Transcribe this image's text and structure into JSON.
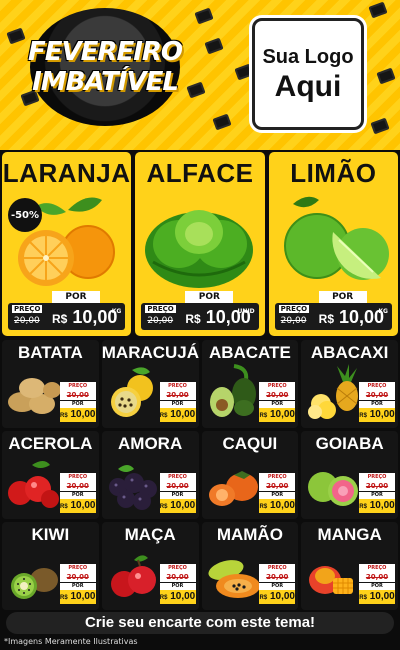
{
  "header": {
    "headline_line1": "FEVEREIRO",
    "headline_line2": "IMBATÍVEL",
    "logo_line1": "Sua Logo",
    "logo_line2": "Aqui",
    "colors": {
      "accent": "#ffd21a",
      "background": "#0c0c0c"
    }
  },
  "featured": [
    {
      "name": "LARANJA",
      "discount": "-50%",
      "price_label": "PREÇO",
      "old_price": "20,00",
      "por": "POR",
      "currency": "R$",
      "price": "10,00",
      "unit": "KG",
      "icon": "orange-icon"
    },
    {
      "name": "ALFACE",
      "discount": "",
      "price_label": "PREÇO",
      "old_price": "20,00",
      "por": "POR",
      "currency": "R$",
      "price": "10,00",
      "unit": "UNID",
      "icon": "lettuce-icon"
    },
    {
      "name": "LIMÃO",
      "discount": "",
      "price_label": "PREÇO",
      "old_price": "20,00",
      "por": "POR",
      "currency": "R$",
      "price": "10,00",
      "unit": "KG",
      "icon": "lime-icon"
    }
  ],
  "products": [
    {
      "name": "BATATA",
      "icon": "potato-icon"
    },
    {
      "name": "MARACUJÁ",
      "icon": "passionfruit-icon"
    },
    {
      "name": "ABACATE",
      "icon": "avocado-icon"
    },
    {
      "name": "ABACAXI",
      "icon": "pineapple-icon"
    },
    {
      "name": "ACEROLA",
      "icon": "acerola-icon"
    },
    {
      "name": "AMORA",
      "icon": "blackberry-icon"
    },
    {
      "name": "CAQUI",
      "icon": "persimmon-icon"
    },
    {
      "name": "GOIABA",
      "icon": "guava-icon"
    },
    {
      "name": "KIWI",
      "icon": "kiwi-icon"
    },
    {
      "name": "MAÇA",
      "icon": "apple-icon"
    },
    {
      "name": "MAMÃO",
      "icon": "papaya-icon"
    },
    {
      "name": "MANGA",
      "icon": "mango-icon"
    }
  ],
  "product_tag": {
    "price_label": "PREÇO",
    "old_price": "20,00",
    "por": "POR",
    "currency": "R$",
    "price": "10,00"
  },
  "footer": {
    "cta": "Crie seu encarte com este tema!",
    "note": "*Imagens Meramente Ilustrativas"
  }
}
